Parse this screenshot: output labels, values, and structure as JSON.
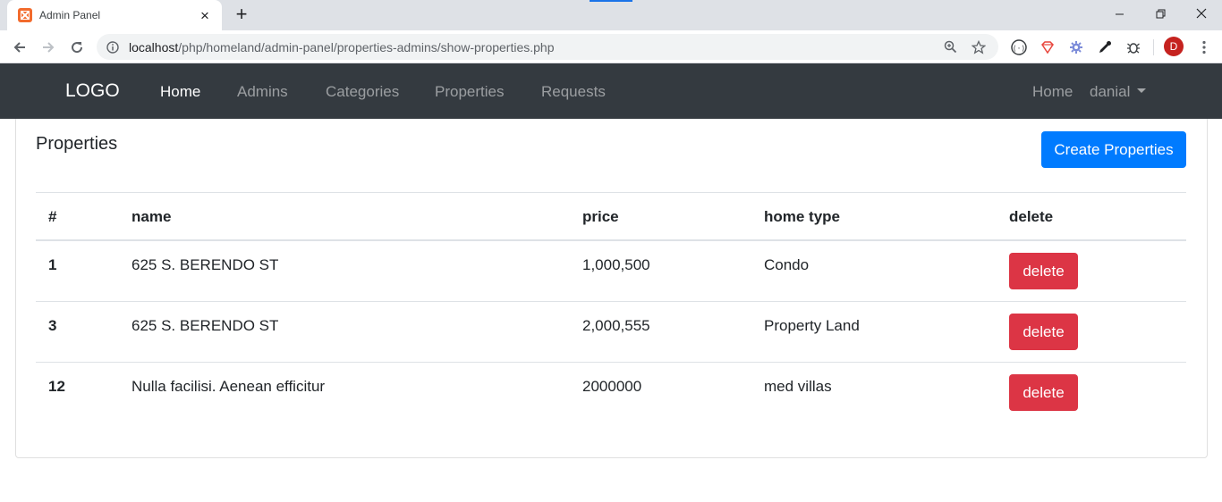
{
  "browser": {
    "tab_title": "Admin Panel",
    "url_host": "localhost",
    "url_path": "/php/homeland/admin-panel/properties-admins/show-properties.php",
    "profile_initial": "D"
  },
  "navbar": {
    "brand": "LOGO",
    "links": [
      "Home",
      "Admins",
      "Categories",
      "Properties",
      "Requests"
    ],
    "right_home": "Home",
    "user": "danial"
  },
  "page": {
    "title": "Properties",
    "create_button": "Create Properties"
  },
  "table": {
    "headers": [
      "#",
      "name",
      "price",
      "home type",
      "delete"
    ],
    "rows": [
      {
        "id": "1",
        "name": "625 S. BERENDO ST",
        "price": "1,000,500",
        "home_type": "Condo",
        "action": "delete"
      },
      {
        "id": "3",
        "name": "625 S. BERENDO ST",
        "price": "2,000,555",
        "home_type": "Property Land",
        "action": "delete"
      },
      {
        "id": "12",
        "name": "Nulla facilisi. Aenean efficitur",
        "price": "2000000",
        "home_type": "med villas",
        "action": "delete"
      }
    ]
  },
  "colors": {
    "navbar_bg": "#343a40",
    "primary": "#007bff",
    "danger": "#dc3545"
  }
}
